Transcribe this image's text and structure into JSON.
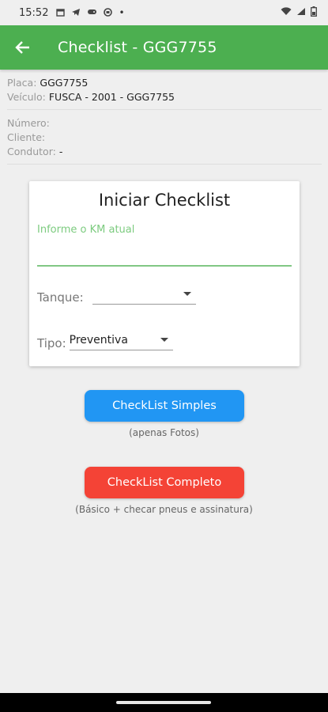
{
  "status_bar": {
    "time": "15:52",
    "notification_icons": [
      "calendar-icon",
      "telegram-icon",
      "game-controller-icon",
      "circle-icon"
    ],
    "dot": "•",
    "right_icons": [
      "wifi-icon",
      "signal-icon",
      "battery-icon"
    ]
  },
  "app_bar": {
    "title": "Checklist - GGG7755",
    "color": "#4caf50"
  },
  "info": {
    "placa_label": "Placa:",
    "placa_value": "GGG7755",
    "veiculo_label": "Veículo:",
    "veiculo_value": "FUSCA  - 2001 - GGG7755",
    "numero_label": "Número:",
    "numero_value": "",
    "cliente_label": "Cliente:",
    "cliente_value": "",
    "condutor_label": "Condutor:",
    "condutor_value": "-"
  },
  "card": {
    "title": "Iniciar Checklist",
    "km_label": "Informe o KM atual",
    "km_value": "",
    "tanque_label": "Tanque:",
    "tanque_value": "",
    "tipo_label": "Tipo:",
    "tipo_value": "Preventiva"
  },
  "buttons": {
    "simple_label": "CheckList Simples",
    "simple_caption": "(apenas Fotos)",
    "simple_color": "#2196f3",
    "complete_label": "CheckList Completo",
    "complete_caption": "(Básico + checar pneus e assinatura)",
    "complete_color": "#f44336"
  }
}
